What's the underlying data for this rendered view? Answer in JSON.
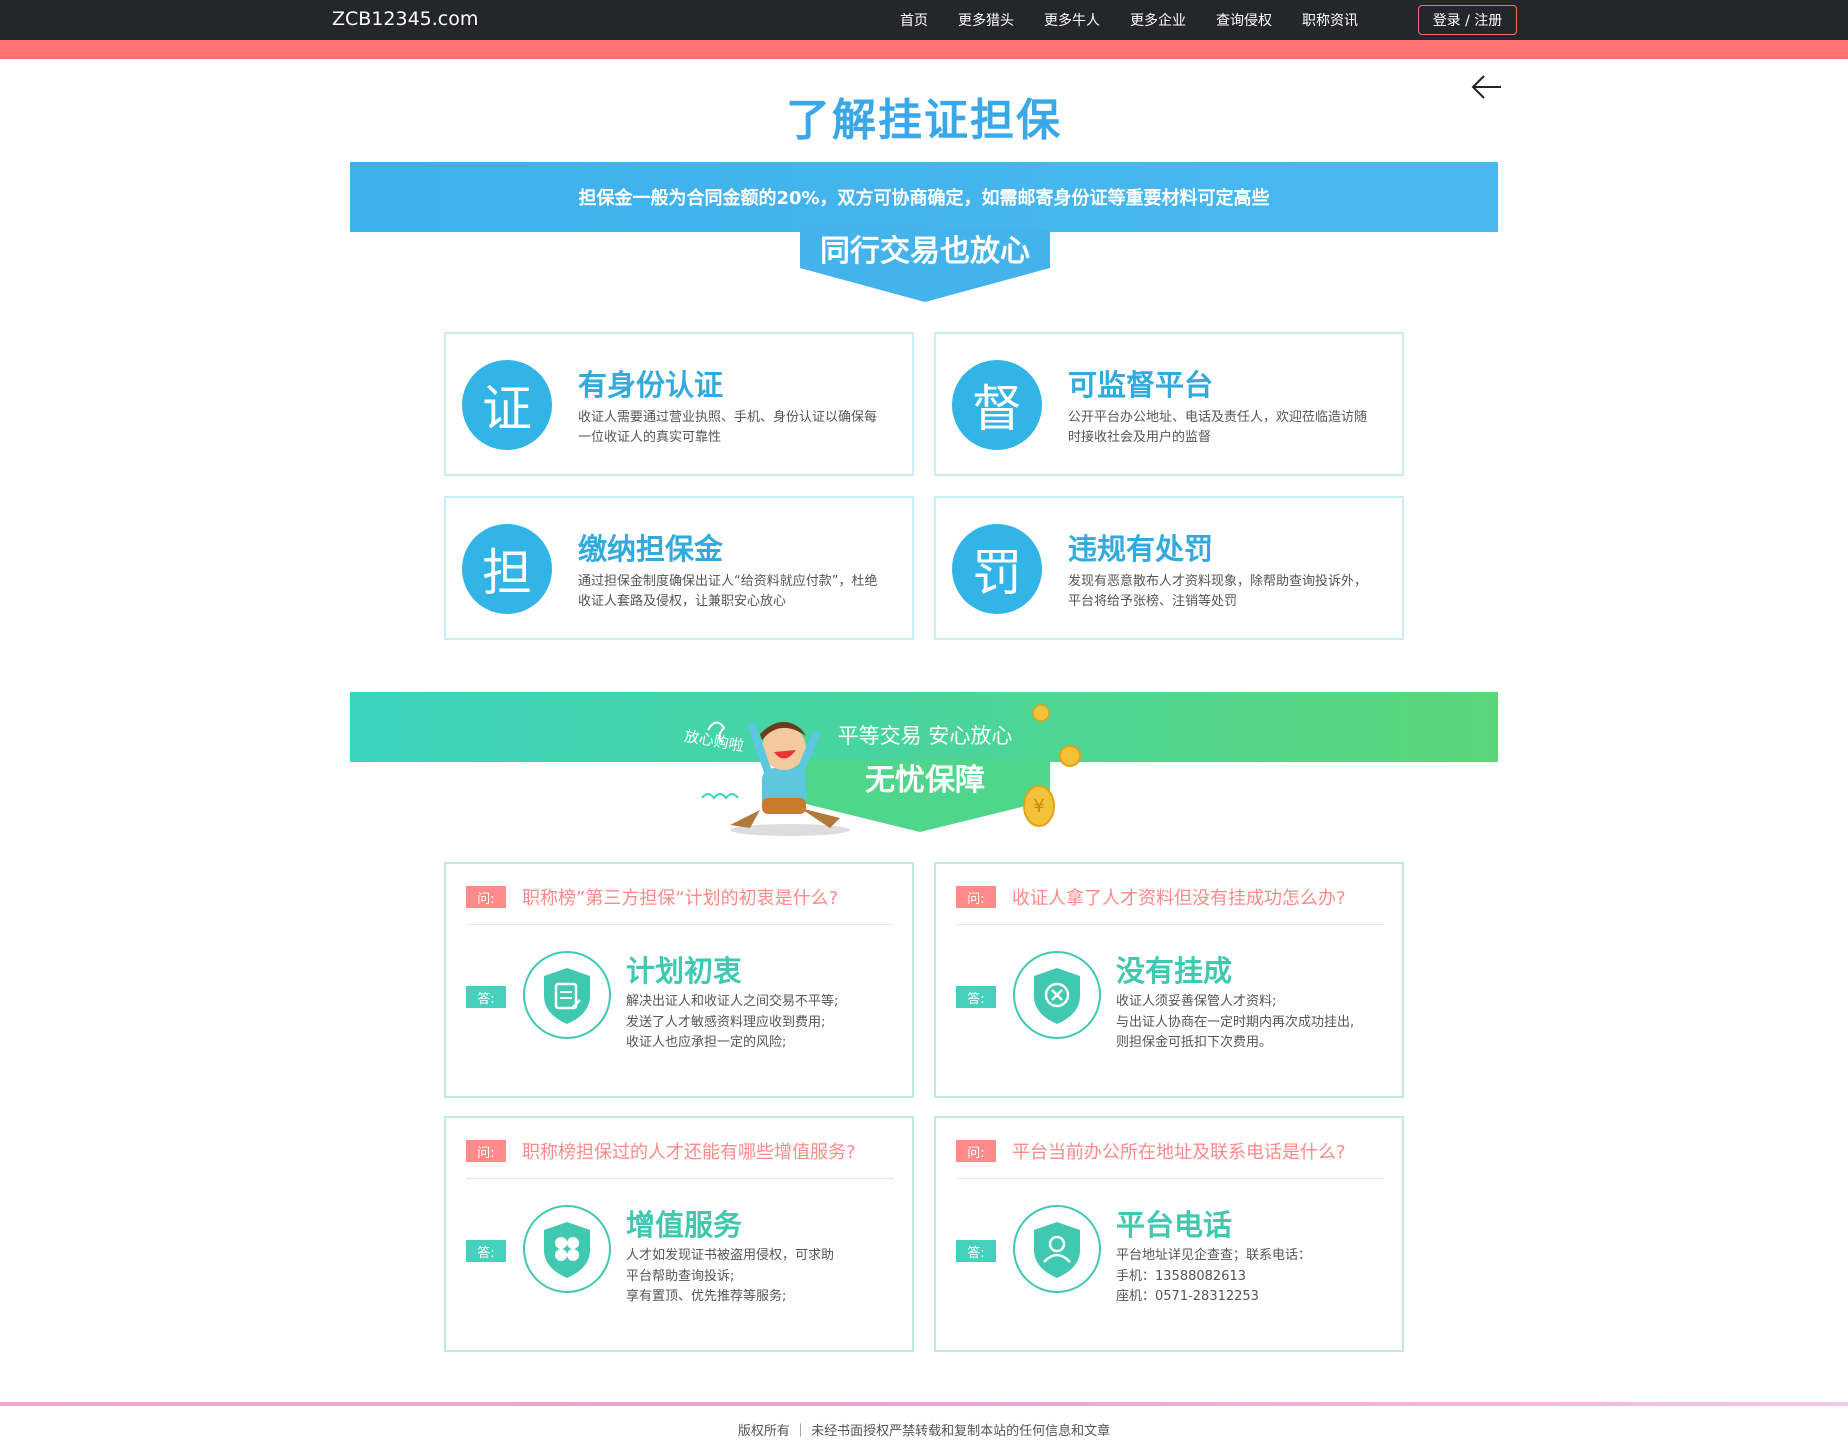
{
  "nav": {
    "brand": "ZCB12345.com",
    "links": [
      "首页",
      "更多猎头",
      "更多牛人",
      "更多企业",
      "查询侵权",
      "职称资讯"
    ],
    "login": "登录 / 注册"
  },
  "title": "了解挂证担保",
  "banner1": {
    "text": "担保金一般为合同金额的20%，双方可协商确定，如需邮寄身份证等重要材料可定高些",
    "tab": "同行交易也放心"
  },
  "features": [
    {
      "glyph": "证",
      "title": "有身份认证",
      "desc": "收证人需要通过营业执照、手机、身份认证以确保每一位收证人的真实可靠性"
    },
    {
      "glyph": "督",
      "title": "可监督平台",
      "desc": "公开平台办公地址、电话及责任人，欢迎莅临造访随时接收社会及用户的监督"
    },
    {
      "glyph": "担",
      "title": "缴纳担保金",
      "desc": "通过担保金制度确保出证人“给资料就应付款”，杜绝收证人套路及侵权，让兼职安心放心"
    },
    {
      "glyph": "罚",
      "title": "违规有处罚",
      "desc": "发现有恶意散布人才资料现象，除帮助查询投诉外，平台将给予张榜、注销等处罚"
    }
  ],
  "banner2": {
    "note": "放心购啦",
    "sub": "平等交易 安心放心",
    "main": "无忧保障"
  },
  "qa": [
    {
      "q_badge": "问:",
      "question": "职称榜”第三方担保“计划的初衷是什么?",
      "a_badge": "答:",
      "icon": "document-shield-icon",
      "title": "计划初衷",
      "lines": [
        "解决出证人和收证人之间交易不平等;",
        "发送了人才敏感资料理应收到费用;",
        "收证人也应承担一定的风险;"
      ]
    },
    {
      "q_badge": "问:",
      "question": "收证人拿了人才资料但没有挂成功怎么办?",
      "a_badge": "答:",
      "icon": "cancel-shield-icon",
      "title": "没有挂成",
      "lines": [
        "收证人须妥善保管人才资料;",
        "与出证人协商在一定时期内再次成功挂出,",
        "则担保金可抵扣下次费用。"
      ]
    },
    {
      "q_badge": "问:",
      "question": "职称榜担保过的人才还能有哪些增值服务?",
      "a_badge": "答:",
      "icon": "clover-shield-icon",
      "title": "增值服务",
      "lines": [
        "人才如发现证书被盗用侵权，可求助",
        "平台帮助查询投诉;",
        "享有置顶、优先推荐等服务;"
      ]
    },
    {
      "q_badge": "问:",
      "question": "平台当前办公所在地址及联系电话是什么?",
      "a_badge": "答:",
      "icon": "user-shield-icon",
      "title": "平台电话",
      "lines": [
        "平台地址详见企查查；联系电话：",
        "手机：13588082613",
        "座机：0571-28312253"
      ]
    }
  ],
  "footer": "版权所有 ｜ 未经书面授权严禁转载和复制本站的任何信息和文章",
  "colors": {
    "nav_bg": "#25262b",
    "pink_accent": "#ff7272",
    "blue_accent": "#33b4e6",
    "green_accent": "#41c8b0",
    "question_pink": "#ff8a8a"
  }
}
